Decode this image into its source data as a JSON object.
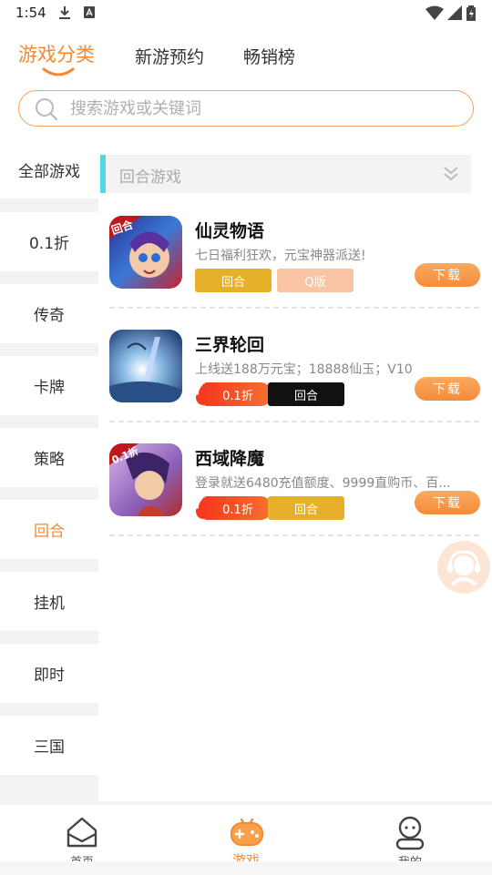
{
  "status_bar": {
    "time": "1:54"
  },
  "top_tabs": [
    {
      "label": "游戏分类",
      "active": true
    },
    {
      "label": "新游预约",
      "active": false
    },
    {
      "label": "畅销榜",
      "active": false
    }
  ],
  "search": {
    "placeholder": "搜索游戏或关键词"
  },
  "sidebar": {
    "items": [
      {
        "label": "全部游戏"
      },
      {
        "label": "0.1折"
      },
      {
        "label": "传奇"
      },
      {
        "label": "卡牌"
      },
      {
        "label": "策略"
      },
      {
        "label": "回合",
        "active": true
      },
      {
        "label": "挂机"
      },
      {
        "label": "即时"
      },
      {
        "label": "三国"
      }
    ]
  },
  "section": {
    "title": "回合游戏"
  },
  "games": [
    {
      "title": "仙灵物语",
      "desc": "七日福利狂欢，元宝神器派送!",
      "icon_text": "回合",
      "tags": [
        "回合",
        "Q版"
      ],
      "download": "下载"
    },
    {
      "title": "三界轮回",
      "desc": "上线送188万元宝；18888仙玉；V10",
      "tags": [
        "0.1折",
        "回合"
      ],
      "download": "下载"
    },
    {
      "title": "西域降魔",
      "desc": "登录就送6480充值额度、9999直购币、百...",
      "icon_text": "0.1折",
      "tags": [
        "0.1折",
        "回合"
      ],
      "download": "下载"
    }
  ],
  "bottom_nav": [
    {
      "label": "首页",
      "icon": "home-icon"
    },
    {
      "label": "游戏",
      "icon": "gamepad-icon",
      "active": true
    },
    {
      "label": "我的",
      "icon": "profile-icon"
    }
  ],
  "colors": {
    "accent": "#f28a34",
    "section_bar": "#4fd7e6",
    "tag_gold": "#e7b02a",
    "discount": "#f53a1f"
  }
}
